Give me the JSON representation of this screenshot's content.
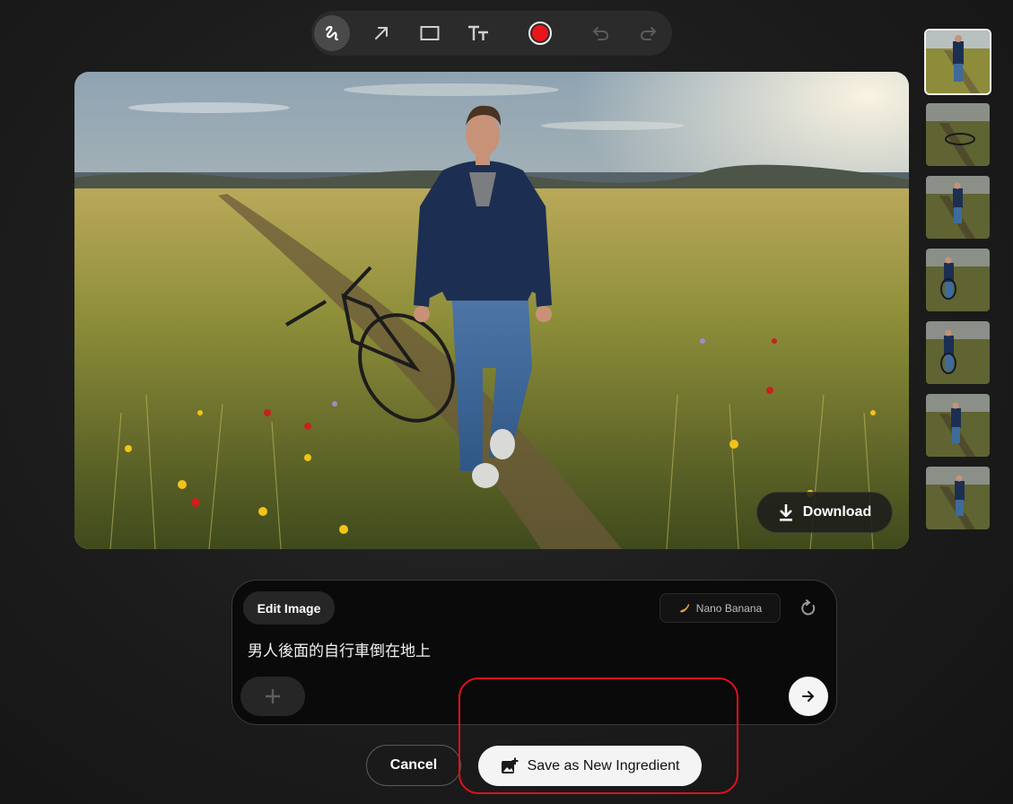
{
  "toolbar": {
    "tools": [
      {
        "name": "freehand-draw",
        "icon": "scribble-icon",
        "active": true
      },
      {
        "name": "arrow",
        "icon": "arrow-up-right-icon",
        "active": false
      },
      {
        "name": "rectangle",
        "icon": "rectangle-icon",
        "active": false
      },
      {
        "name": "text",
        "icon": "text-size-icon",
        "active": false
      },
      {
        "name": "color",
        "icon": "color-dot-icon",
        "color": "#e8161b"
      },
      {
        "name": "undo",
        "icon": "undo-icon",
        "enabled": false
      },
      {
        "name": "redo",
        "icon": "redo-icon",
        "enabled": false
      }
    ]
  },
  "preview": {
    "download_label": "Download",
    "download_icon": "download-icon"
  },
  "thumbnails": {
    "count": 7,
    "selected_index": 0
  },
  "prompt_panel": {
    "mode_label": "Edit Image",
    "model_label": "Nano Banana",
    "model_icon": "banana-icon",
    "prompt_text": "男人後面的自行車倒在地上",
    "add_icon": "plus-icon",
    "send_icon": "arrow-right-icon",
    "refresh_icon": "refresh-icon"
  },
  "actions": {
    "cancel_label": "Cancel",
    "save_label": "Save as New Ingredient",
    "save_icon": "add-image-icon"
  },
  "colors": {
    "highlight": "#e3101a",
    "record_dot": "#e8161b"
  }
}
